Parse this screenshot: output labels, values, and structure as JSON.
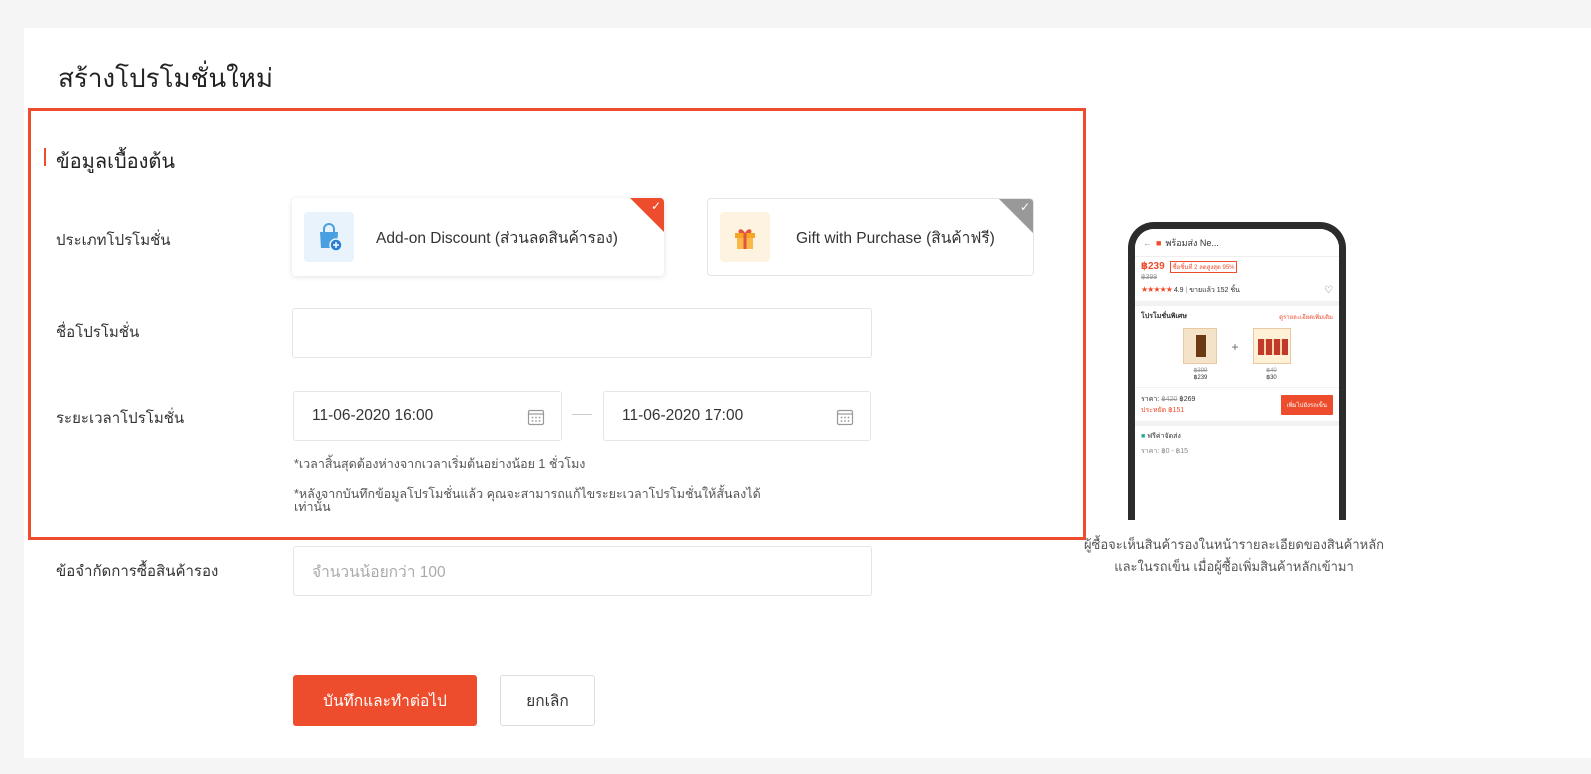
{
  "page": {
    "title": "สร้างโปรโมชั่นใหม่"
  },
  "section": {
    "title": "ข้อมูลเบื้องต้น"
  },
  "form": {
    "promotion_type": {
      "label": "ประเภทโปรโมชั่น",
      "options": [
        {
          "label": "Add-on Discount (ส่วนลดสินค้ารอง)",
          "icon": "shopping-bag-plus-icon",
          "selected": true
        },
        {
          "label": "Gift with Purchase (สินค้าฟรี)",
          "icon": "gift-icon",
          "selected": false
        }
      ]
    },
    "promotion_name": {
      "label": "ชื่อโปรโมชั่น",
      "value": "",
      "placeholder": ""
    },
    "promotion_period": {
      "label": "ระยะเวลาโปรโมชั่น",
      "start": "11-06-2020 16:00",
      "end": "11-06-2020 17:00",
      "hint1": "*เวลาสิ้นสุดต้องห่างจากเวลาเริ่มต้นอย่างน้อย 1 ชั่วโมง",
      "hint2_line1": "*หลังจากบันทึกข้อมูลโปรโมชั่นแล้ว คุณจะสามารถแก้ไขระยะเวลาโปรโมชั่นให้สั้นลงได้",
      "hint2_line2": "เท่านั้น"
    },
    "purchase_limit": {
      "label": "ข้อจำกัดการซื้อสินค้ารอง",
      "placeholder": "จำนวนน้อยกว่า 100"
    }
  },
  "buttons": {
    "save": "บันทึกและทำต่อไป",
    "cancel": "ยกเลิก"
  },
  "preview": {
    "header_text": "พร้อมส่ง Ne...",
    "price": "฿239",
    "price_tag": "ซื้อชิ้นที่ 2 ลดสูงสุด 95%",
    "original_price": "฿399",
    "rating": "4.9",
    "sold": "ขายแล้ว 152 ชิ้น",
    "promo_title": "โปรโมชั่นพิเศษ",
    "promo_link": "ดูรายละเอียดเพิ่มเติม",
    "main_old": "฿399",
    "main_new": "฿239",
    "addon_old": "฿40",
    "addon_new": "฿30",
    "total_label": "ราคา:",
    "total_old": "฿420",
    "total_new": "฿269",
    "save_text": "ประหยัด ฿151",
    "cart_btn": "เพิ่มไปยังรถเข็น",
    "ship_label": "ฟรีค่าจัดส่ง",
    "ship_cost": "ราคา: ฿0 - ฿15",
    "caption_line1": "ผู้ซื้อจะเห็นสินค้ารองในหน้ารายละเอียดของสินค้าหลัก",
    "caption_line2": "และในรถเข็น เมื่อผู้ซื้อเพิ่มสินค้าหลักเข้ามา"
  },
  "colors": {
    "accent": "#ee4d2d",
    "border": "#e5e5e5",
    "page_bg": "#f5f5f5"
  }
}
